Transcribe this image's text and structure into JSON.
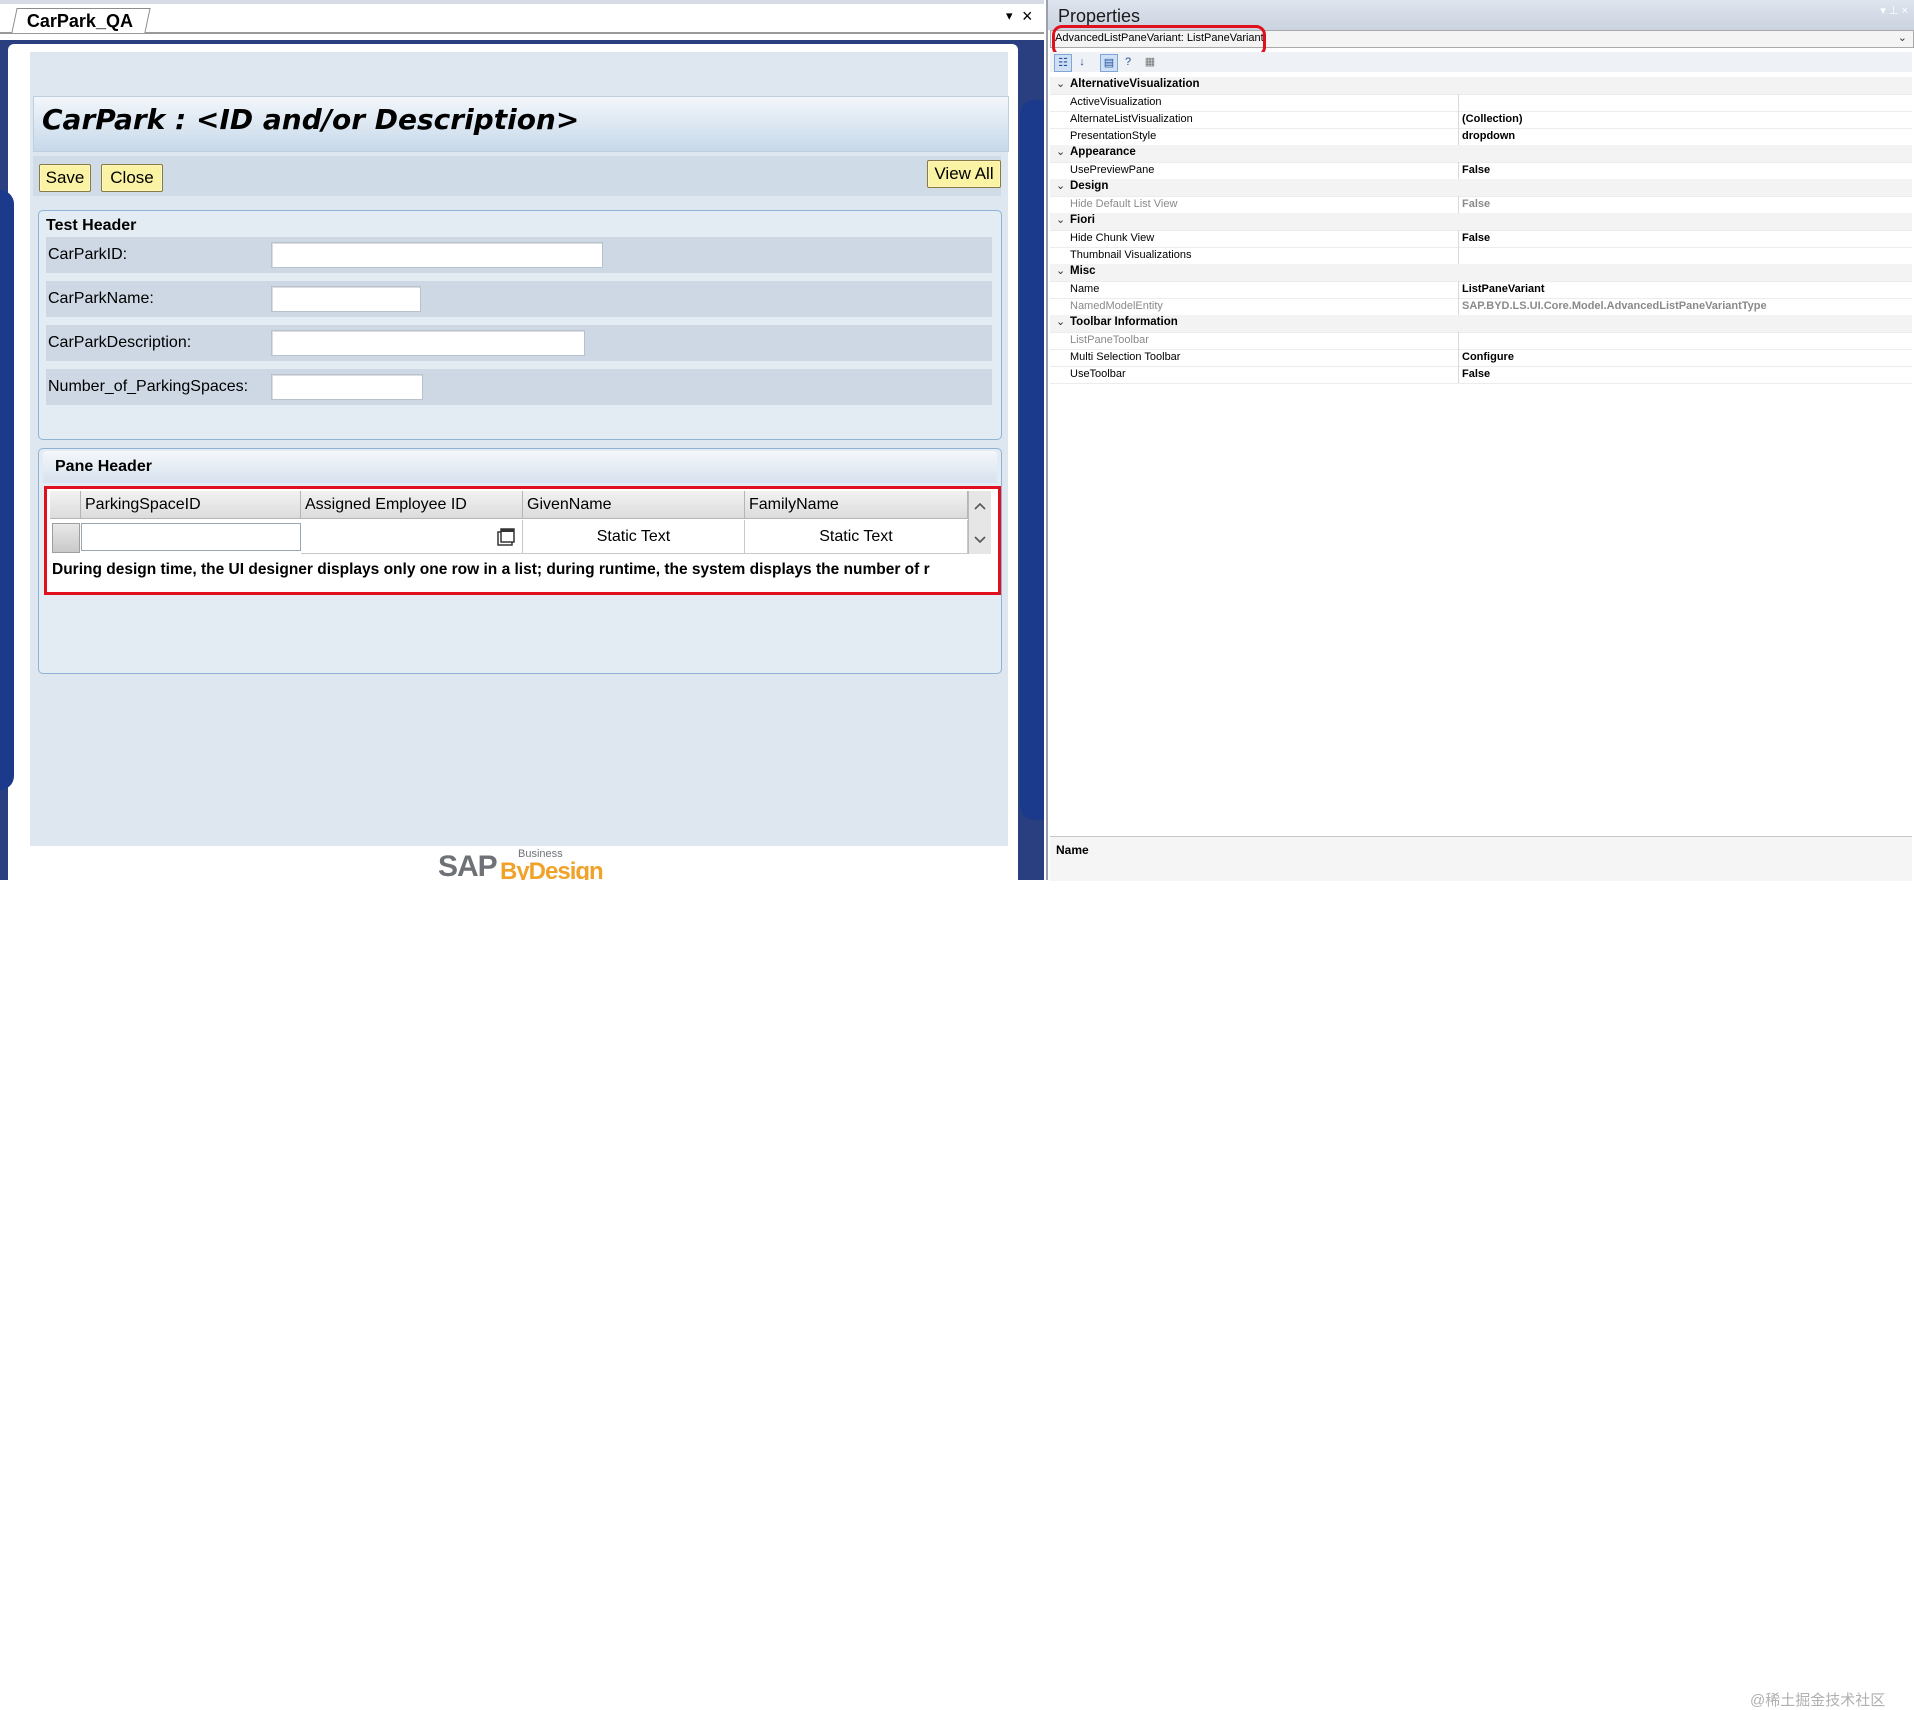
{
  "document_tab": {
    "title": "CarPark_QA"
  },
  "page": {
    "title": "CarPark : <ID and/or Description>"
  },
  "toolbar": {
    "save_label": "Save",
    "close_label": "Close",
    "view_all_label": "View All"
  },
  "test_header": {
    "title": "Test Header",
    "fields": [
      {
        "label": "CarParkID:"
      },
      {
        "label": "CarParkName:"
      },
      {
        "label": "CarParkDescription:"
      },
      {
        "label": "Number_of_ParkingSpaces:"
      }
    ]
  },
  "pane": {
    "title": "Pane Header",
    "columns": [
      "ParkingSpaceID",
      "Assigned Employee ID",
      "GivenName",
      "FamilyName"
    ],
    "row": {
      "given_name": "Static Text",
      "family_name": "Static Text"
    },
    "design_note": "During design time, the UI designer displays only one row in a list; during runtime, the system displays the number of r"
  },
  "logo": {
    "sap": "SAP",
    "business": "Business",
    "bydesign": "ByDesign"
  },
  "properties": {
    "title": "Properties",
    "selected_object": "AdvancedListPaneVariant: ListPaneVariant",
    "rows": [
      {
        "kind": "category",
        "name": "AlternativeVisualization"
      },
      {
        "kind": "prop",
        "name": "ActiveVisualization",
        "value": ""
      },
      {
        "kind": "prop",
        "name": "AlternateListVisualization",
        "value": "(Collection)"
      },
      {
        "kind": "prop",
        "name": "PresentationStyle",
        "value": "dropdown"
      },
      {
        "kind": "category",
        "name": "Appearance"
      },
      {
        "kind": "prop",
        "name": "UsePreviewPane",
        "value": "False"
      },
      {
        "kind": "category",
        "name": "Design"
      },
      {
        "kind": "prop",
        "name": "Hide Default List View",
        "value": "False",
        "disabled": true
      },
      {
        "kind": "category",
        "name": "Fiori"
      },
      {
        "kind": "prop",
        "name": "Hide Chunk View",
        "value": "False"
      },
      {
        "kind": "prop",
        "name": "Thumbnail Visualizations",
        "value": ""
      },
      {
        "kind": "category",
        "name": "Misc"
      },
      {
        "kind": "prop",
        "name": "Name",
        "value": "ListPaneVariant"
      },
      {
        "kind": "prop",
        "name": "NamedModelEntity",
        "value": "SAP.BYD.LS.UI.Core.Model.AdvancedListPaneVariantType",
        "disabled": true
      },
      {
        "kind": "category",
        "name": "Toolbar Information"
      },
      {
        "kind": "prop",
        "name": "ListPaneToolbar",
        "value": "",
        "disabled": true
      },
      {
        "kind": "prop",
        "name": "Multi Selection Toolbar",
        "value": "Configure"
      },
      {
        "kind": "prop",
        "name": "UseToolbar",
        "value": "False"
      }
    ],
    "footer_name": "Name"
  },
  "watermark": "@稀土掘金技术社区",
  "colors": {
    "highlight": "#e0101e",
    "button_yellow": "#fbf3a4",
    "frame_blue": "#2a3f80"
  }
}
